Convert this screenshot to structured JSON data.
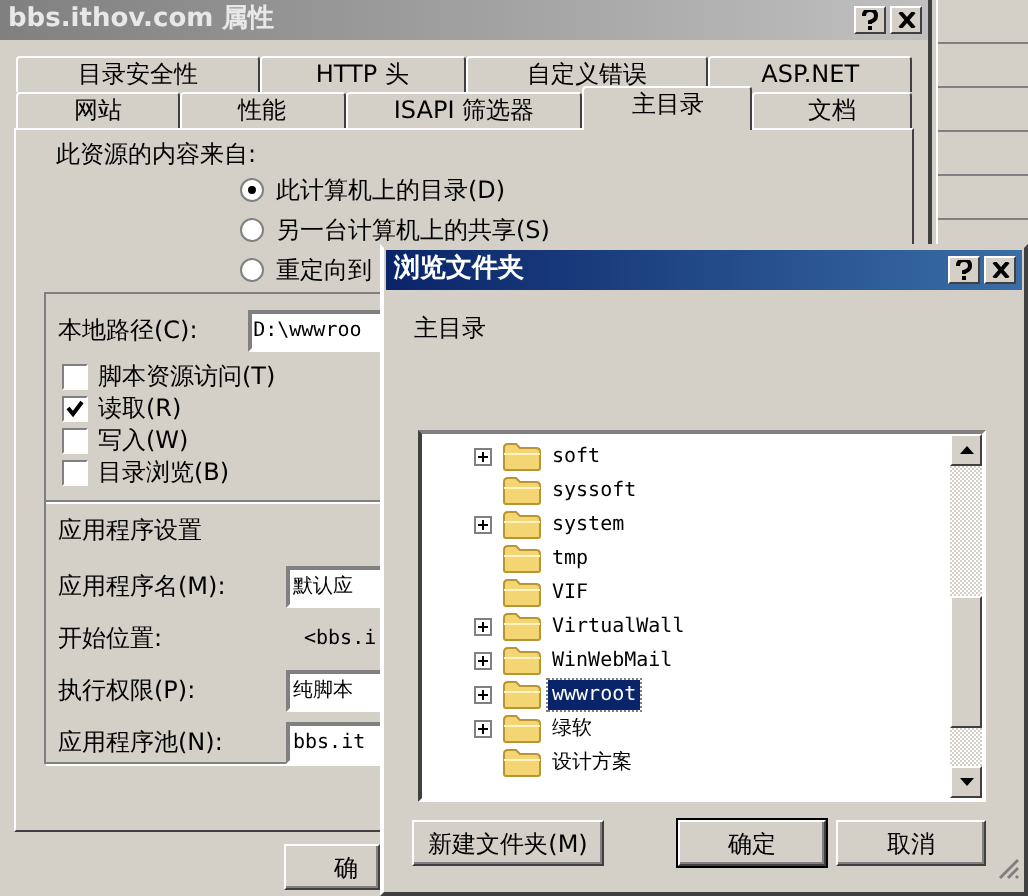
{
  "main_window": {
    "title": "bbs.ithov.com 属性",
    "tabs_top": [
      {
        "label": "目录安全性",
        "selected": false
      },
      {
        "label": "HTTP 头",
        "selected": false
      },
      {
        "label": "自定义错误",
        "selected": false
      },
      {
        "label": "ASP.NET",
        "selected": false
      }
    ],
    "tabs_bottom": [
      {
        "label": "网站",
        "selected": false
      },
      {
        "label": "性能",
        "selected": false
      },
      {
        "label": "ISAPI 筛选器",
        "selected": false
      },
      {
        "label": "主目录",
        "selected": true
      },
      {
        "label": "文档",
        "selected": false
      }
    ],
    "source_label": "此资源的内容来自:",
    "source_options": [
      {
        "label": "此计算机上的目录(D)",
        "selected": true
      },
      {
        "label": "另一台计算机上的共享(S)",
        "selected": false
      },
      {
        "label": "重定向到",
        "selected": false
      }
    ],
    "local_path": {
      "label": "本地路径(C):",
      "value": "D:\\wwwroo"
    },
    "permissions": [
      {
        "label": "脚本资源访问(T)",
        "checked": false
      },
      {
        "label": "读取(R)",
        "checked": true
      },
      {
        "label": "写入(W)",
        "checked": false
      },
      {
        "label": "目录浏览(B)",
        "checked": false
      }
    ],
    "app_settings": {
      "title": "应用程序设置",
      "rows": [
        {
          "kind": "field",
          "label": "应用程序名(M):",
          "value": "默认应"
        },
        {
          "kind": "text",
          "label": "开始位置:",
          "value": "<bbs.i"
        },
        {
          "kind": "field",
          "label": "执行权限(P):",
          "value": "纯脚本"
        },
        {
          "kind": "field",
          "label": "应用程序池(N):",
          "value": "bbs.it"
        }
      ]
    },
    "ok_button": "确"
  },
  "browse_dialog": {
    "title": "浏览文件夹",
    "prompt": "主目录",
    "folders": [
      {
        "name": "soft",
        "expandable": true,
        "selected": false
      },
      {
        "name": "syssoft",
        "expandable": false,
        "selected": false
      },
      {
        "name": "system",
        "expandable": true,
        "selected": false
      },
      {
        "name": "tmp",
        "expandable": false,
        "selected": false
      },
      {
        "name": "VIF",
        "expandable": false,
        "selected": false
      },
      {
        "name": "VirtualWall",
        "expandable": true,
        "selected": false
      },
      {
        "name": "WinWebMail",
        "expandable": true,
        "selected": false
      },
      {
        "name": "wwwroot",
        "expandable": true,
        "selected": true
      },
      {
        "name": "绿软",
        "expandable": true,
        "selected": false
      },
      {
        "name": "设计方案",
        "expandable": false,
        "selected": false
      }
    ],
    "buttons": [
      "新建文件夹(M)",
      "确定",
      "取消"
    ]
  }
}
